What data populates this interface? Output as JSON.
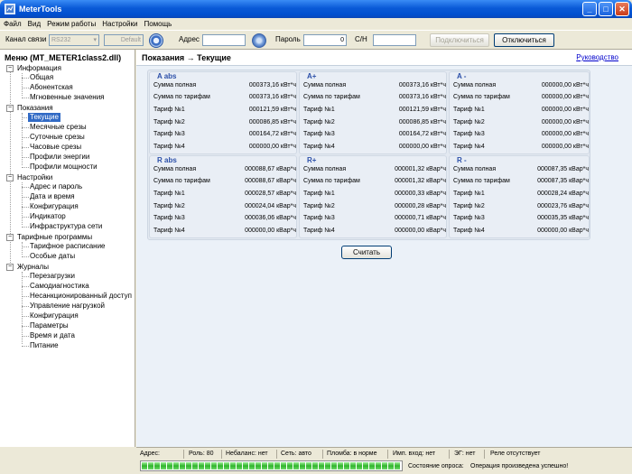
{
  "window": {
    "title": "MeterTools"
  },
  "menu": [
    "Файл",
    "Вид",
    "Режим работы",
    "Настройки",
    "Помощь"
  ],
  "toolbar": {
    "channel_label": "Канал связи",
    "channel_value": "RS232",
    "default_value": "Default",
    "address_label": "Адрес",
    "address_value": "",
    "password_label": "Пароль",
    "password_value": "0",
    "serial_label": "С/Н",
    "serial_value": "",
    "connect_label": "Подключиться",
    "disconnect_label": "Отключиться"
  },
  "sidebar": {
    "title": "Меню (MT_METER1class2.dll)",
    "groups": [
      {
        "label": "Информация",
        "items": [
          "Общая",
          "Абонентская",
          "Мгновенные значения"
        ]
      },
      {
        "label": "Показания",
        "items": [
          "Текущие",
          "Месячные срезы",
          "Суточные срезы",
          "Часовые срезы",
          "Профили энергии",
          "Профили мощности"
        ]
      },
      {
        "label": "Настройки",
        "items": [
          "Адрес и пароль",
          "Дата и время",
          "Конфигурация",
          "Индикатор",
          "Инфраструктура сети"
        ]
      },
      {
        "label": "Тарифные программы",
        "items": [
          "Тарифное расписание",
          "Особые даты"
        ]
      },
      {
        "label": "Журналы",
        "items": [
          "Перезагрузки",
          "Самодиагностика",
          "Несанкционированный доступ",
          "Управление нагрузкой",
          "Конфигурация",
          "Параметры",
          "Время и дата",
          "Питание"
        ]
      }
    ],
    "selected": "Текущие"
  },
  "header": {
    "breadcrumb": "Показания → Текущие",
    "help_link": "Руководство"
  },
  "groups": [
    {
      "title": "A abs",
      "rows": [
        {
          "label": "Сумма полная",
          "value": "000373,16 кВт*ч"
        },
        {
          "label": "Сумма по тарифам",
          "value": "000373,16 кВт*ч"
        },
        {
          "label": "Тариф №1",
          "value": "000121,59 кВт*ч"
        },
        {
          "label": "Тариф №2",
          "value": "000086,85 кВт*ч"
        },
        {
          "label": "Тариф №3",
          "value": "000164,72 кВт*ч"
        },
        {
          "label": "Тариф №4",
          "value": "000000,00 кВт*ч"
        }
      ]
    },
    {
      "title": "A+",
      "rows": [
        {
          "label": "Сумма полная",
          "value": "000373,16 кВт*ч"
        },
        {
          "label": "Сумма по тарифам",
          "value": "000373,16 кВт*ч"
        },
        {
          "label": "Тариф №1",
          "value": "000121,59 кВт*ч"
        },
        {
          "label": "Тариф №2",
          "value": "000086,85 кВт*ч"
        },
        {
          "label": "Тариф №3",
          "value": "000164,72 кВт*ч"
        },
        {
          "label": "Тариф №4",
          "value": "000000,00 кВт*ч"
        }
      ]
    },
    {
      "title": "A -",
      "rows": [
        {
          "label": "Сумма полная",
          "value": "000000,00 кВт*ч"
        },
        {
          "label": "Сумма по тарифам",
          "value": "000000,00 кВт*ч"
        },
        {
          "label": "Тариф №1",
          "value": "000000,00 кВт*ч"
        },
        {
          "label": "Тариф №2",
          "value": "000000,00 кВт*ч"
        },
        {
          "label": "Тариф №3",
          "value": "000000,00 кВт*ч"
        },
        {
          "label": "Тариф №4",
          "value": "000000,00 кВт*ч"
        }
      ]
    },
    {
      "title": "R abs",
      "rows": [
        {
          "label": "Сумма полная",
          "value": "000088,67 кВар*ч"
        },
        {
          "label": "Сумма по тарифам",
          "value": "000088,67 кВар*ч"
        },
        {
          "label": "Тариф №1",
          "value": "000028,57 кВар*ч"
        },
        {
          "label": "Тариф №2",
          "value": "000024,04 кВар*ч"
        },
        {
          "label": "Тариф №3",
          "value": "000036,06 кВар*ч"
        },
        {
          "label": "Тариф №4",
          "value": "000000,00 кВар*ч"
        }
      ]
    },
    {
      "title": "R+",
      "rows": [
        {
          "label": "Сумма полная",
          "value": "000001,32 кВар*ч"
        },
        {
          "label": "Сумма по тарифам",
          "value": "000001,32 кВар*ч"
        },
        {
          "label": "Тариф №1",
          "value": "000000,33 кВар*ч"
        },
        {
          "label": "Тариф №2",
          "value": "000000,28 кВар*ч"
        },
        {
          "label": "Тариф №3",
          "value": "000000,71 кВар*ч"
        },
        {
          "label": "Тариф №4",
          "value": "000000,00 кВар*ч"
        }
      ]
    },
    {
      "title": "R -",
      "rows": [
        {
          "label": "Сумма полная",
          "value": "000087,35 кВар*ч"
        },
        {
          "label": "Сумма по тарифам",
          "value": "000087,35 кВар*ч"
        },
        {
          "label": "Тариф №1",
          "value": "000028,24 кВар*ч"
        },
        {
          "label": "Тариф №2",
          "value": "000023,76 кВар*ч"
        },
        {
          "label": "Тариф №3",
          "value": "000035,35 кВар*ч"
        },
        {
          "label": "Тариф №4",
          "value": "000000,00 кВар*ч"
        }
      ]
    }
  ],
  "read_button": "Считать",
  "status": {
    "address": "Адрес:",
    "role": "Роль: 80",
    "imbalance": "Небаланс: нет",
    "network": "Сеть: авто",
    "seal": "Пломба: в норме",
    "pulse_input": "Имп. вход: нет",
    "em": "ЭГ: нет",
    "relay": "Реле отсутствует",
    "poll_state_label": "Состояние опроса:",
    "poll_state_value": "Операция произведена успешно!",
    "progress": 1.0
  },
  "colors": {
    "title_bar": "#0a5ad7",
    "selection": "#316ac5",
    "group_title": "#2b4fa8",
    "progress": "#2fb42b"
  }
}
